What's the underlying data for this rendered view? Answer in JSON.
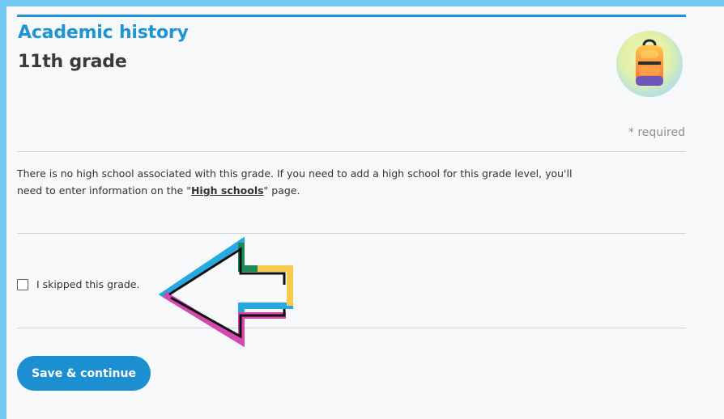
{
  "page": {
    "section_title": "Academic history",
    "grade_title": "11th grade",
    "required_note": "* required"
  },
  "info": {
    "text_before_link": "There is no high school associated with this grade. If you need to add a high school for this grade level, you'll need to enter information on the \"",
    "link_text": "High schools",
    "text_after_link": "\" page."
  },
  "form": {
    "skip_label": "I skipped this grade.",
    "skip_checked": false,
    "save_button_label": "Save & continue"
  },
  "icons": {
    "badge": "backpack-icon",
    "annotation": "arrow-pointer-icon"
  },
  "colors": {
    "accent": "#1e95d2",
    "button": "#1b8fd0",
    "background": "#f7f8fa",
    "outer_frame": "#74c6f3"
  }
}
